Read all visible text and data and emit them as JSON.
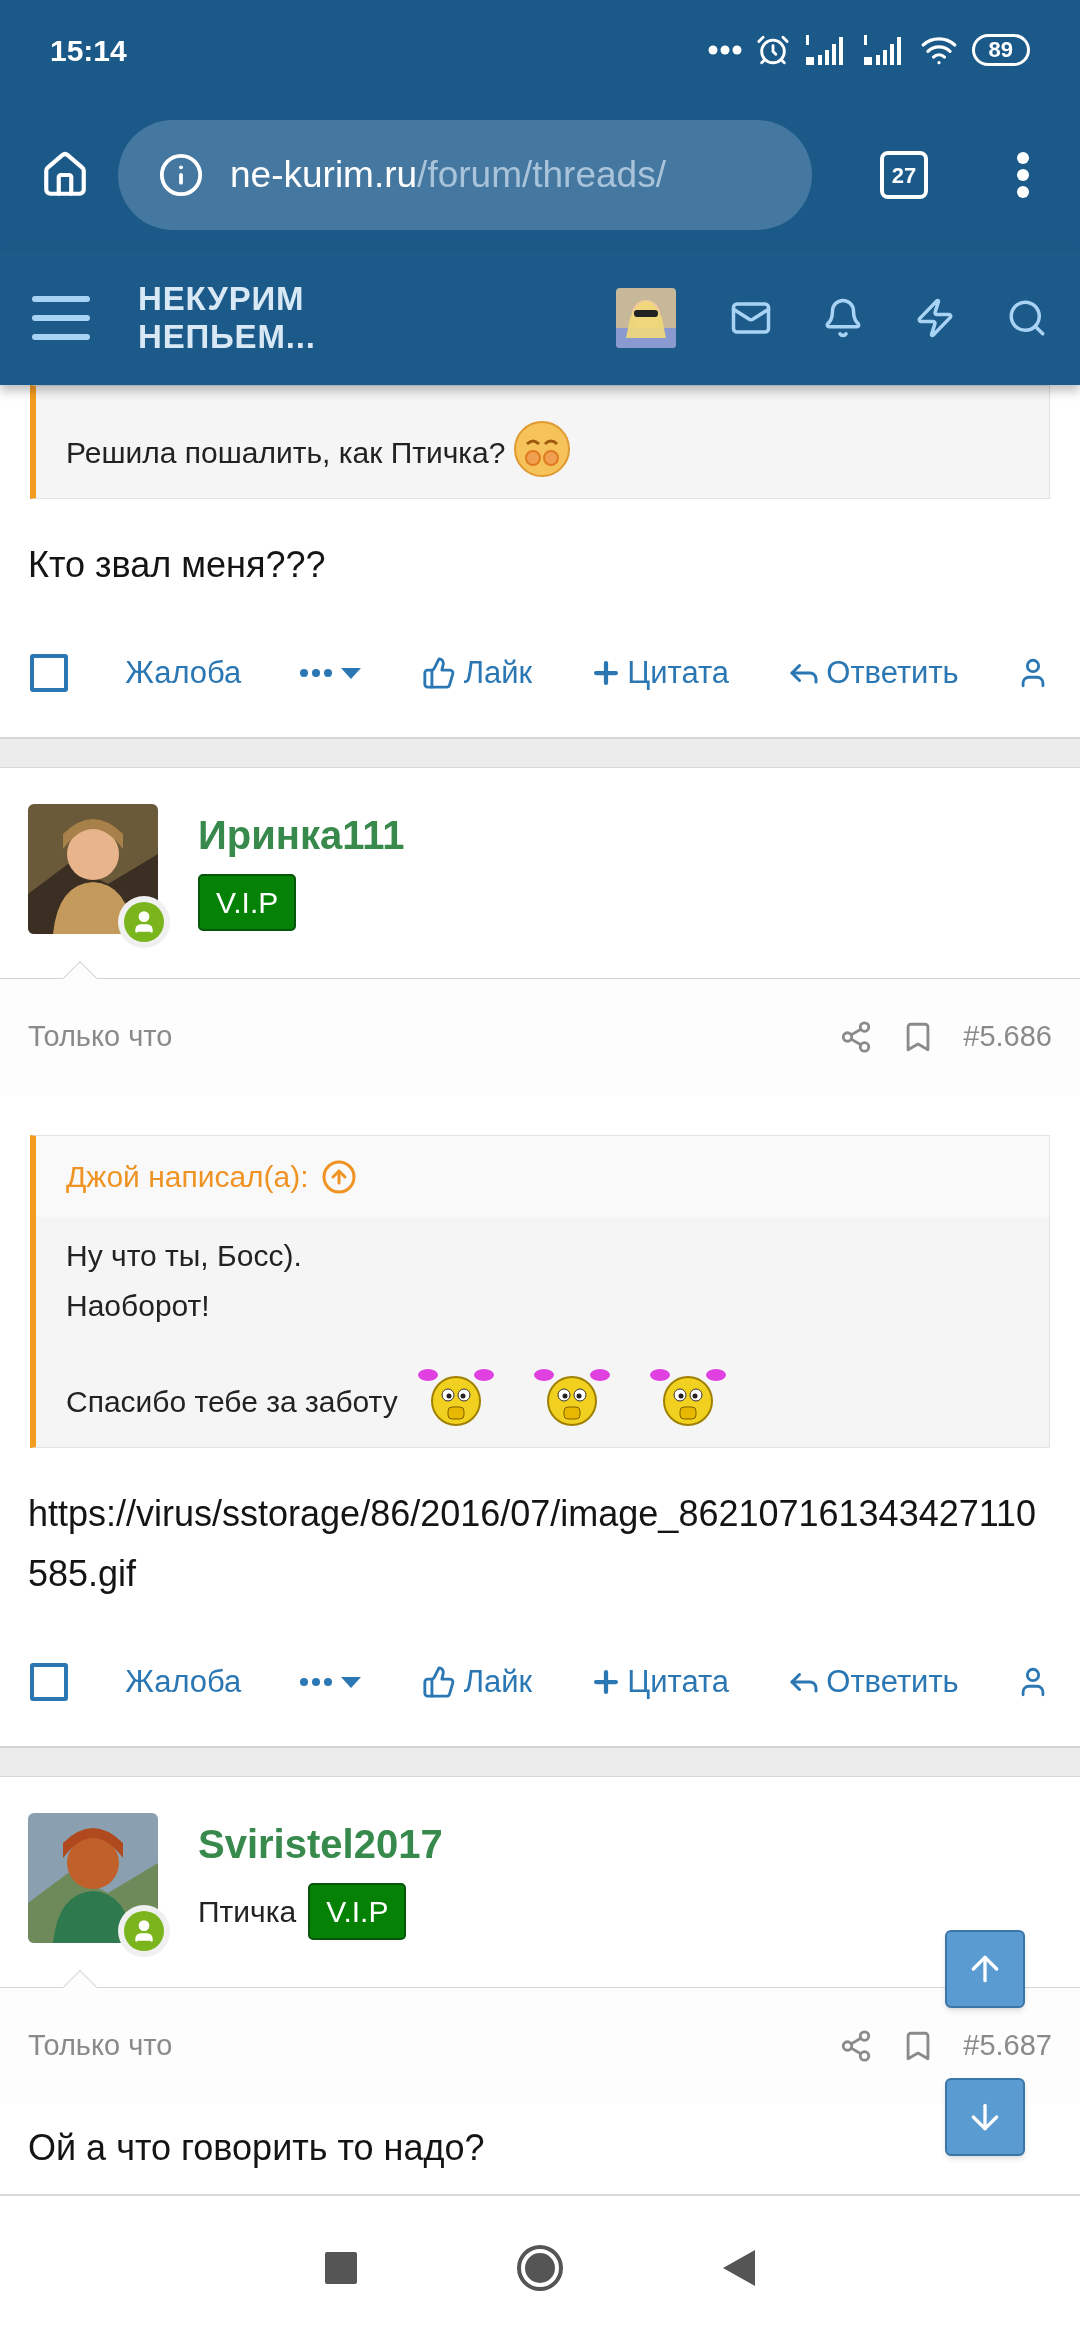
{
  "status_bar": {
    "time": "15:14",
    "battery": "89"
  },
  "browser": {
    "url_host": "ne-kurim.ru",
    "url_path": "/forum/threads/",
    "tab_count": "27"
  },
  "site_header": {
    "logo_lines": [
      "НЕКУРИМ",
      "НЕПЬЕМ..."
    ]
  },
  "posts": [
    {
      "quote": {
        "paragraphs": [
          {
            "lines": [
              "Решила пошалить, как Птичка?"
            ],
            "smileys": [
              {
                "kind": "blush"
              }
            ]
          }
        ]
      },
      "body": [
        "Кто звал меня???"
      ],
      "actions": [
        {
          "kind": "checkbox",
          "checked": false
        },
        {
          "kind": "report",
          "label": "Жалоба"
        },
        {
          "kind": "more"
        },
        {
          "kind": "like",
          "label": "Лайк"
        },
        {
          "kind": "quote",
          "label": "Цитата"
        },
        {
          "kind": "reply",
          "label": "Ответить"
        },
        {
          "kind": "user"
        }
      ]
    },
    {
      "author": {
        "name": "Иринка111",
        "badge": "V.I.P",
        "online": true
      },
      "meta": {
        "time": "Только что",
        "number": "#5.686"
      },
      "quote": {
        "header": "Джой написал(а):",
        "paragraphs": [
          {
            "lines": [
              "Ну что ты, Босс).",
              "Наоборот!"
            ]
          },
          {
            "lines": [
              "Спасибо тебе за заботу"
            ],
            "smileys": [
              {
                "kind": "pigtails"
              },
              {
                "kind": "pigtails"
              },
              {
                "kind": "pigtails"
              }
            ]
          }
        ]
      },
      "body": [
        "https://virus/sstorage/86/2016/07/image_862107161343427110585.gif"
      ],
      "actions": [
        {
          "kind": "checkbox",
          "checked": false
        },
        {
          "kind": "report",
          "label": "Жалоба"
        },
        {
          "kind": "more"
        },
        {
          "kind": "like",
          "label": "Лайк"
        },
        {
          "kind": "quote",
          "label": "Цитата"
        },
        {
          "kind": "reply",
          "label": "Ответить"
        },
        {
          "kind": "user"
        }
      ]
    },
    {
      "author": {
        "name": "Sviristel2017",
        "title": "Птичка",
        "badge": "V.I.P",
        "online": true
      },
      "meta": {
        "time": "Только что",
        "number": "#5.687"
      },
      "body": [
        "Ой а что говорить то надо?"
      ]
    }
  ]
}
